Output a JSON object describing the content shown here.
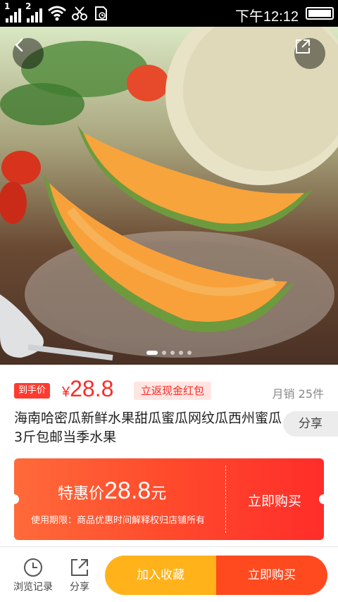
{
  "status_bar": {
    "time": "下午12:12",
    "sim1": "1",
    "sim2": "2"
  },
  "nav": {
    "back_icon": "chevron-left-icon",
    "share_icon": "external-share-icon"
  },
  "carousel": {
    "count": 5,
    "active_index": 0
  },
  "price": {
    "hand_tag": "到手价",
    "currency": "¥",
    "amount": "28.8",
    "cashback_tag": "立返现金红包",
    "monthly_sales": "月销 25件"
  },
  "product": {
    "title": "海南哈密瓜新鲜水果甜瓜蜜瓜网纹瓜西州蜜瓜3斤包邮当季水果",
    "share_label": "分享"
  },
  "coupon": {
    "label": "特惠价",
    "price": "28.8",
    "unit": "元",
    "note": "使用期限：商品优惠时间解释权归店铺所有",
    "action": "立即购买"
  },
  "bottom_bar": {
    "history_label": "浏览记录",
    "share_label": "分享",
    "favorite_label": "加入收藏",
    "buy_label": "立即购买"
  },
  "colors": {
    "accent_red": "#ff2a26",
    "orange": "#ffb21a",
    "status_bg": "#000000"
  }
}
